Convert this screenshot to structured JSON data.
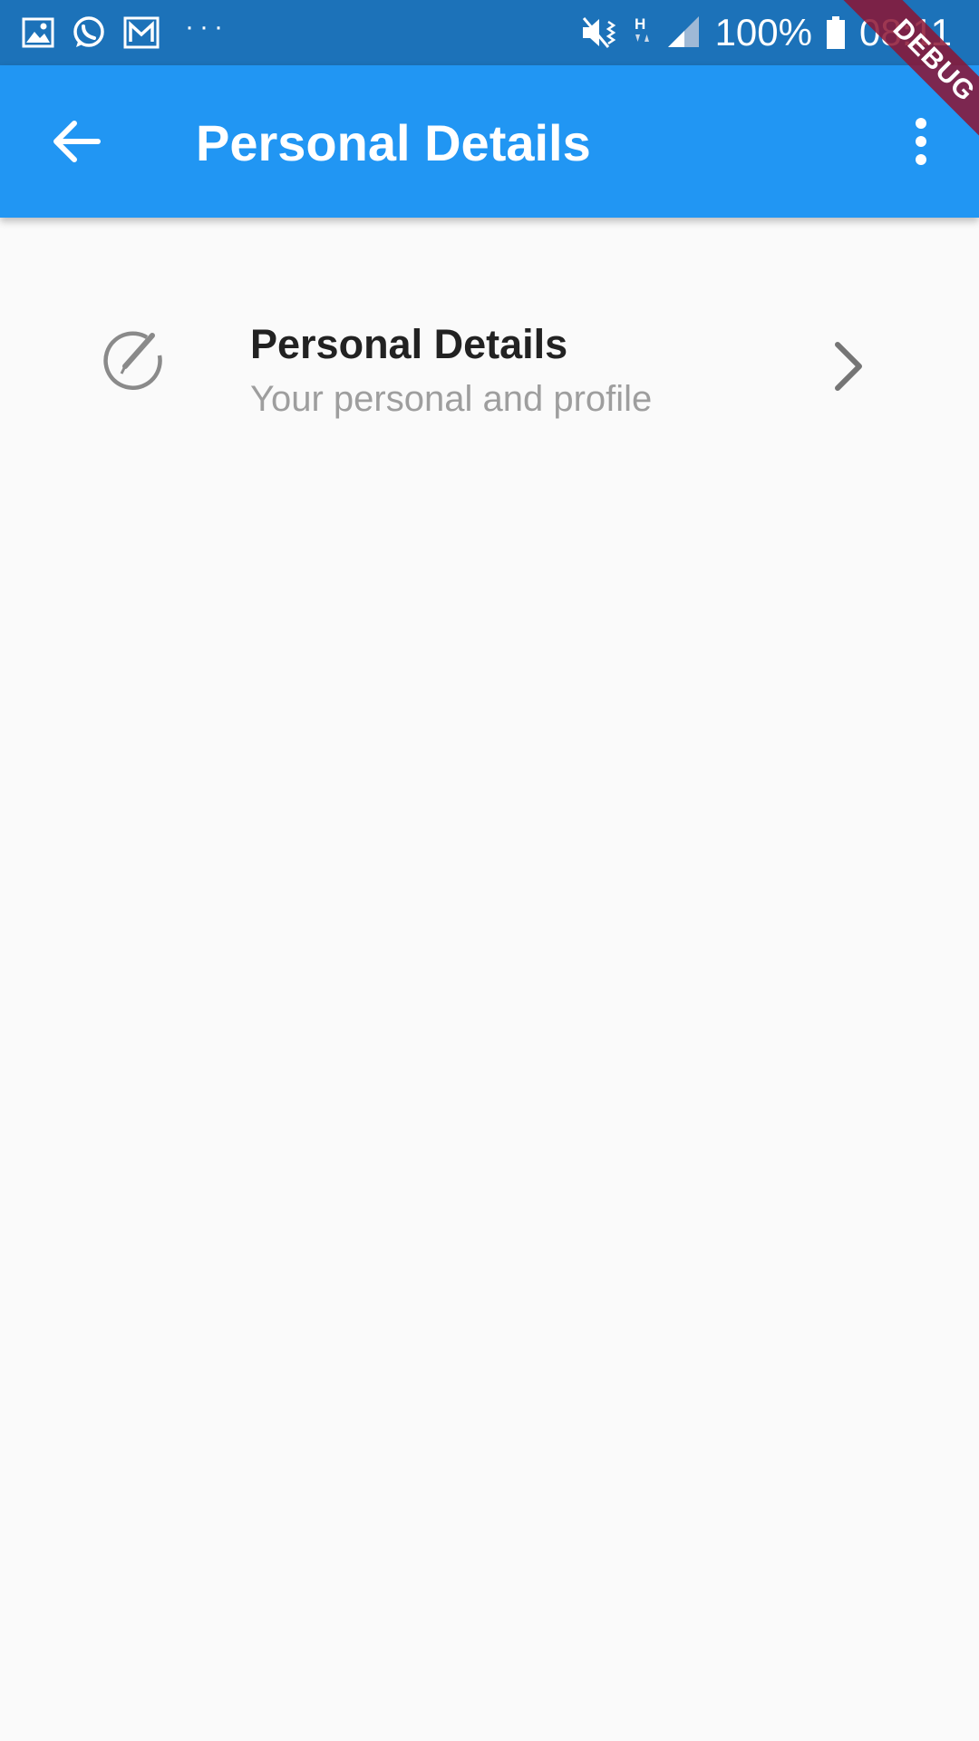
{
  "status_bar": {
    "left_icons": [
      "gallery-icon",
      "whatsapp-icon",
      "mail-icon"
    ],
    "more_indicator": "···",
    "right_icons": [
      "mute-vibrate-icon",
      "hspa-data-icon",
      "signal-icon"
    ],
    "battery_percent": "100%",
    "time": "08:11"
  },
  "app_bar": {
    "title": "Personal Details",
    "back_icon": "arrow-back-icon",
    "menu_icon": "more-vert-icon",
    "background_color": "#2196f3"
  },
  "list": {
    "items": [
      {
        "title": "Personal Details",
        "subtitle": "Your personal and profile",
        "leading_icon": "edit-circle-icon",
        "trailing_icon": "chevron-right-icon"
      }
    ]
  },
  "debug_banner": {
    "label": "DEBUG",
    "color": "#8c1432"
  }
}
